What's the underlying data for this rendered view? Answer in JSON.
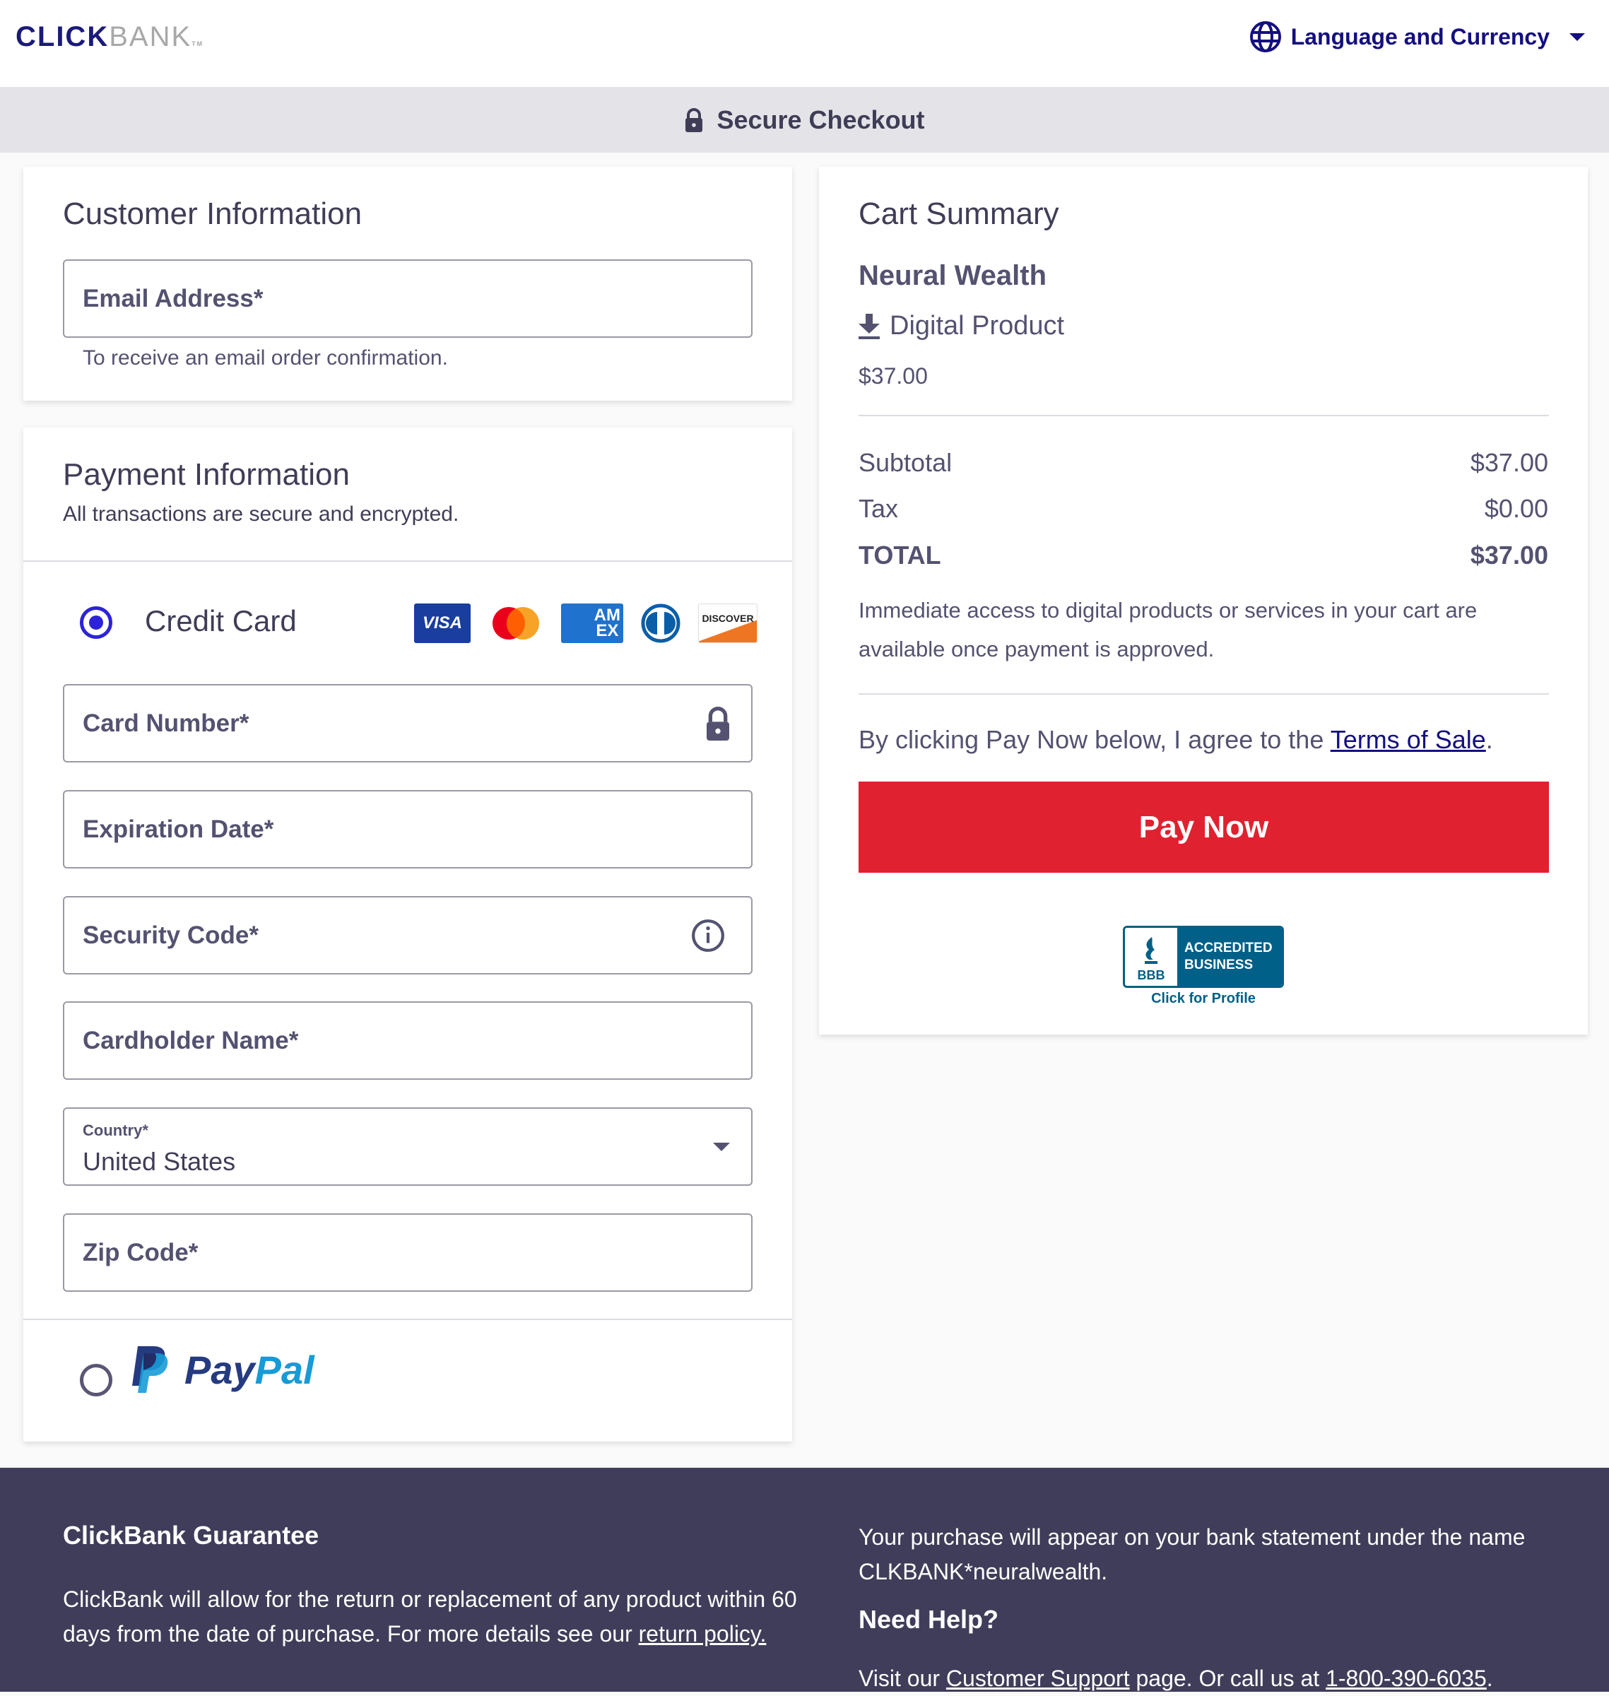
{
  "header": {
    "logo_click": "CLICK",
    "logo_bank": "BANK",
    "logo_tm": "TM",
    "language_currency_label": "Language and Currency",
    "globe_icon": "globe-icon",
    "caret_icon": "caret-down-icon"
  },
  "secure_bar": {
    "label": "Secure Checkout",
    "icon": "lock-icon"
  },
  "customer_info": {
    "title": "Customer Information",
    "email_label": "Email Address*",
    "email_hint": "To receive an email order confirmation."
  },
  "payment_info": {
    "title": "Payment Information",
    "subtitle": "All transactions are secure and encrypted.",
    "methods": [
      {
        "label": "Credit Card",
        "selected": true
      },
      {
        "label": "PayPal",
        "selected": false
      }
    ],
    "card_brands": [
      "VISA",
      "Mastercard",
      "AMEX",
      "Diners Club",
      "DISCOVER"
    ],
    "fields": {
      "card_number": "Card Number*",
      "expiration": "Expiration Date*",
      "security_code": "Security Code*",
      "cardholder": "Cardholder Name*",
      "country_label": "Country*",
      "country_value": "United States",
      "zip": "Zip Code*"
    },
    "paypal_pay": "Pay",
    "paypal_pal": "Pal"
  },
  "cart": {
    "title": "Cart Summary",
    "product_name": "Neural Wealth",
    "product_type": "Digital Product",
    "product_price": "$37.00",
    "subtotal_label": "Subtotal",
    "subtotal_value": "$37.00",
    "tax_label": "Tax",
    "tax_value": "$0.00",
    "total_label": "TOTAL",
    "total_value": "$37.00",
    "access_note": "Immediate access to digital products or services in your cart are available once payment is approved.",
    "agree_prefix": "By clicking Pay Now below, I agree to the ",
    "terms_link": "Terms of Sale",
    "agree_suffix": ".",
    "pay_button": "Pay Now",
    "bbb_line1": "ACCREDITED",
    "bbb_line2": "BUSINESS",
    "bbb_mark": "BBB",
    "bbb_profile": "Click for Profile",
    "colors": {
      "pay_button": "#e0212f",
      "bbb": "#006087"
    }
  },
  "footer": {
    "guarantee_title": "ClickBank Guarantee",
    "guarantee_text": "ClickBank will allow for the return or replacement of any product within 60 days from the date of purchase. For more details see our ",
    "return_policy_link": "return policy.",
    "statement_text": "Your purchase will appear on your bank statement under the name CLKBANK*neuralwealth.",
    "help_title": "Need Help?",
    "help_prefix": "Visit our ",
    "support_link": "Customer Support",
    "help_middle": " page. Or call us at ",
    "phone_link": "1-800-390-6035",
    "help_suffix": "."
  }
}
